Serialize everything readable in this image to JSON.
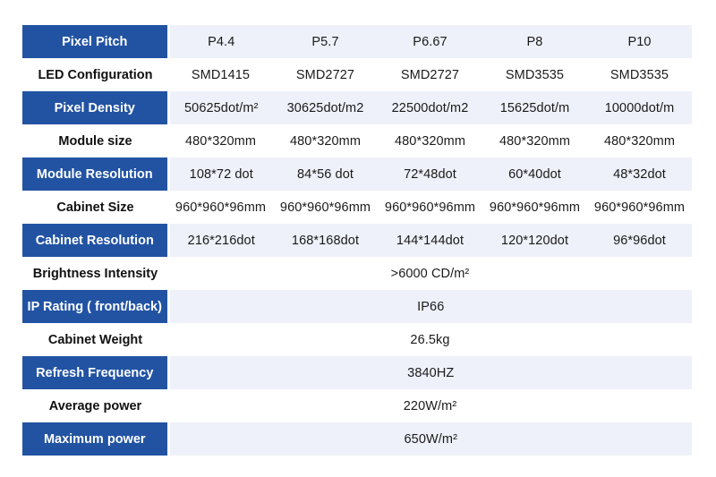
{
  "table": {
    "rows": [
      {
        "label": "Pixel Pitch",
        "values": [
          "P4.4",
          "P5.7",
          "P6.67",
          "P8",
          "P10"
        ]
      },
      {
        "label": "LED Configuration",
        "values": [
          "SMD1415",
          "SMD2727",
          "SMD2727",
          "SMD3535",
          "SMD3535"
        ]
      },
      {
        "label": "Pixel Density",
        "values": [
          "50625dot/m²",
          "30625dot/m2",
          "22500dot/m2",
          "15625dot/m",
          "10000dot/m"
        ]
      },
      {
        "label": "Module size",
        "values": [
          "480*320mm",
          "480*320mm",
          "480*320mm",
          "480*320mm",
          "480*320mm"
        ]
      },
      {
        "label": "Module Resolution",
        "values": [
          "108*72 dot",
          "84*56 dot",
          "72*48dot",
          "60*40dot",
          "48*32dot"
        ]
      },
      {
        "label": "Cabinet Size",
        "values": [
          "960*960*96mm",
          "960*960*96mm",
          "960*960*96mm",
          "960*960*96mm",
          "960*960*96mm"
        ]
      },
      {
        "label": "Cabinet Resolution",
        "values": [
          "216*216dot",
          "168*168dot",
          "144*144dot",
          "120*120dot",
          "96*96dot"
        ]
      },
      {
        "label": "Brightness Intensity",
        "value": ">6000 CD/m²"
      },
      {
        "label": "IP Rating ( front/back)",
        "value": "IP66"
      },
      {
        "label": "Cabinet Weight",
        "value": "26.5kg"
      },
      {
        "label": "Refresh Frequency",
        "value": "3840HZ"
      },
      {
        "label": "Average power",
        "value": "220W/m²"
      },
      {
        "label": "Maximum power",
        "value": "650W/m²"
      }
    ]
  },
  "colors": {
    "label_shaded_bg": "#2253a3",
    "value_shaded_bg": "#eef1f9"
  }
}
